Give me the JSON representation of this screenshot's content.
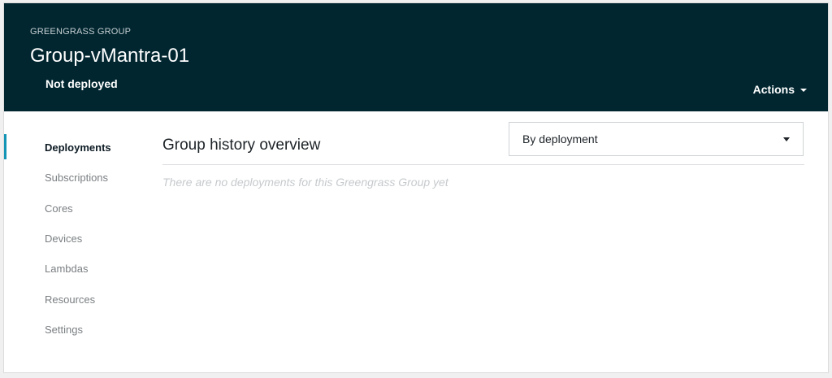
{
  "header": {
    "eyebrow": "GREENGRASS GROUP",
    "title": "Group-vMantra-01",
    "status": "Not deployed",
    "actions_label": "Actions"
  },
  "sidebar": {
    "items": [
      {
        "label": "Deployments",
        "active": true
      },
      {
        "label": "Subscriptions",
        "active": false
      },
      {
        "label": "Cores",
        "active": false
      },
      {
        "label": "Devices",
        "active": false
      },
      {
        "label": "Lambdas",
        "active": false
      },
      {
        "label": "Resources",
        "active": false
      },
      {
        "label": "Settings",
        "active": false
      }
    ]
  },
  "main": {
    "section_title": "Group history overview",
    "view_select": {
      "selected": "By deployment"
    },
    "empty_message": "There are no deployments for this Greengrass Group yet"
  },
  "colors": {
    "header_bg": "#012630",
    "accent": "#1495b5"
  },
  "icons": {
    "actions_caret": "caret-down-icon",
    "dropdown_caret": "caret-down-icon"
  }
}
